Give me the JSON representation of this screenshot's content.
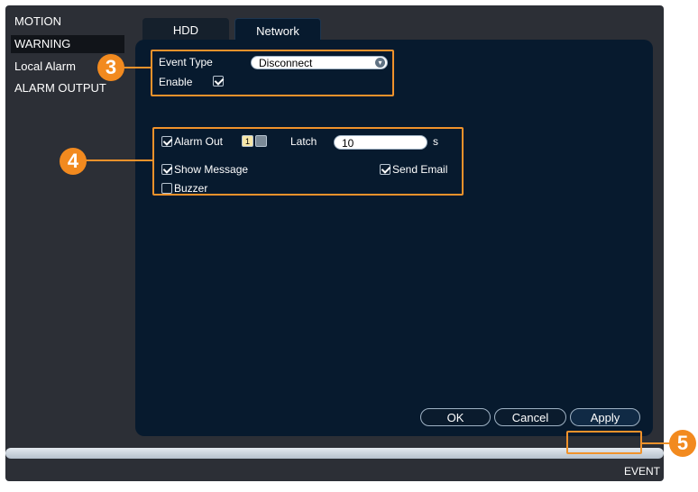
{
  "sidebar": {
    "items": [
      {
        "label": "MOTION",
        "active": false
      },
      {
        "label": "WARNING",
        "active": true
      },
      {
        "label": "Local Alarm",
        "active": false
      },
      {
        "label": "ALARM OUTPUT",
        "active": false
      }
    ]
  },
  "tabs": [
    {
      "label": "HDD",
      "active": false
    },
    {
      "label": "Network",
      "active": true
    }
  ],
  "form": {
    "event_type_label": "Event Type",
    "event_type_value": "Disconnect",
    "enable_label": "Enable",
    "enable_checked": true,
    "alarm_out_label": "Alarm Out",
    "alarm_out_checked": true,
    "alarm_channel_1": "1",
    "latch_label": "Latch",
    "latch_value": "10",
    "latch_unit": "s",
    "show_message_label": "Show Message",
    "show_message_checked": true,
    "send_email_label": "Send Email",
    "send_email_checked": true,
    "buzzer_label": "Buzzer",
    "buzzer_checked": false
  },
  "buttons": {
    "ok": "OK",
    "cancel": "Cancel",
    "apply": "Apply"
  },
  "callouts": {
    "c3": "3",
    "c4": "4",
    "c5": "5"
  },
  "footer": {
    "label": "EVENT"
  },
  "colors": {
    "highlight": "#f0922b",
    "panel": "#071a2e",
    "window": "#2c2f36"
  }
}
